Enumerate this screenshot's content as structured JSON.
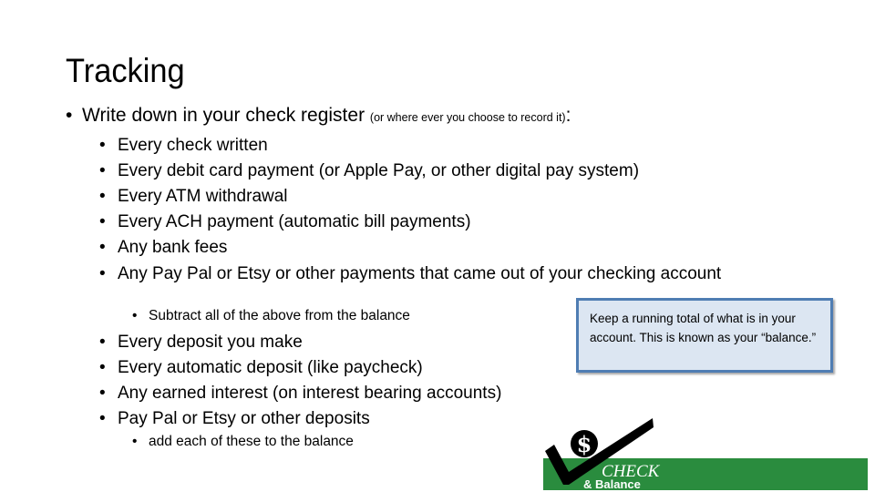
{
  "slide": {
    "title": "Tracking",
    "main_point": {
      "bullet": "•",
      "text": "Write down in your check register ",
      "aside": "(or where ever you choose to record it)",
      "colon": ":"
    },
    "subtract_items": [
      "Every check written",
      "Every debit card payment (or Apple Pay, or other digital pay system)",
      "Every ATM withdrawal",
      "Every ACH payment (automatic bill payments)",
      "Any bank fees",
      "Any Pay Pal or Etsy or other payments that came out of your checking account"
    ],
    "subtract_note": "Subtract all of the above from the balance",
    "add_items": [
      "Every deposit you make",
      "Every automatic deposit (like paycheck)",
      "Any earned interest (on interest bearing accounts)",
      "Pay Pal or Etsy or other deposits"
    ],
    "add_note": "add each of these to the balance",
    "bullet_glyph": "•",
    "callout": {
      "text": "Keep a running total of what is in your account.  This is known as your “balance.”"
    },
    "logo": {
      "icon": "dollar-check-icon",
      "symbol": "$",
      "word1": "CHECK",
      "word2": "& Balance",
      "colors": {
        "bar": "#2a8c3e",
        "check": "#000000",
        "text": "#ffffff"
      }
    }
  }
}
